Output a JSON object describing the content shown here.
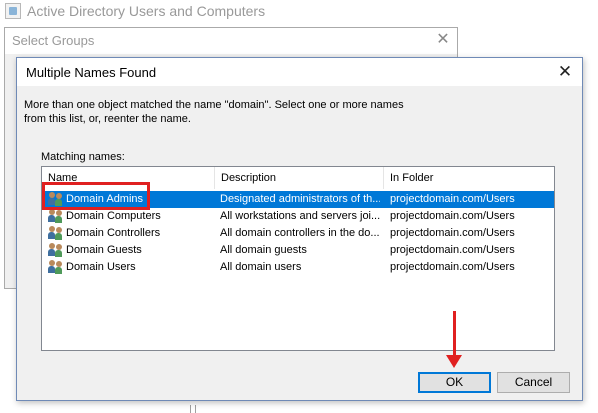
{
  "background_window": {
    "title": "Active Directory Users and Computers"
  },
  "select_groups": {
    "title": "Select Groups",
    "close_glyph": "✕"
  },
  "dialog": {
    "title": "Multiple Names Found",
    "close_glyph": "✕",
    "message_line1": "More than one object matched the name \"domain\". Select one or more names",
    "message_line2": "from this list, or, reenter the name.",
    "matching_label": "Matching names:",
    "columns": {
      "name": "Name",
      "description": "Description",
      "folder": "In Folder"
    },
    "rows": [
      {
        "name": "Domain Admins",
        "description": "Designated administrators of th...",
        "folder": "projectdomain.com/Users",
        "selected": true,
        "icon": "group-icon"
      },
      {
        "name": "Domain Computers",
        "description": "All workstations and servers joi...",
        "folder": "projectdomain.com/Users",
        "selected": false,
        "icon": "group-icon"
      },
      {
        "name": "Domain Controllers",
        "description": "All domain controllers in the do...",
        "folder": "projectdomain.com/Users",
        "selected": false,
        "icon": "group-icon"
      },
      {
        "name": "Domain Guests",
        "description": "All domain guests",
        "folder": "projectdomain.com/Users",
        "selected": false,
        "icon": "group-icon"
      },
      {
        "name": "Domain Users",
        "description": "All domain users",
        "folder": "projectdomain.com/Users",
        "selected": false,
        "icon": "group-icon"
      }
    ],
    "ok_label": "OK",
    "cancel_label": "Cancel"
  },
  "colors": {
    "selection": "#0078d7",
    "annotation": "#e02020"
  }
}
